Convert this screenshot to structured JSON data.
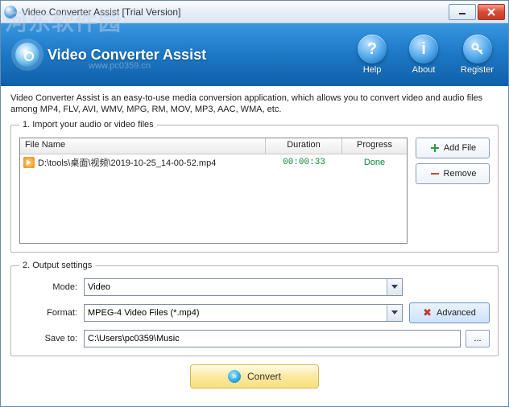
{
  "window": {
    "title": "Video Converter Assist [Trial Version]"
  },
  "header": {
    "app_name": "Video Converter Assist",
    "buttons": {
      "help": "Help",
      "about": "About",
      "register": "Register"
    }
  },
  "description": "Video Converter Assist is an easy-to-use media conversion application, which allows you to convert video and audio files among MP4, FLV, AVI, WMV, MPG, RM, MOV, MP3, AAC, WMA, etc.",
  "import": {
    "legend": "1. Import your audio or video files",
    "columns": {
      "name": "File Name",
      "duration": "Duration",
      "progress": "Progress"
    },
    "rows": [
      {
        "name": "D:\\tools\\桌面\\视频\\2019-10-25_14-00-52.mp4",
        "duration": "00:00:33",
        "progress": "Done"
      }
    ],
    "add_label": "Add File",
    "remove_label": "Remove"
  },
  "output": {
    "legend": "2. Output settings",
    "mode_label": "Mode:",
    "mode_value": "Video",
    "format_label": "Format:",
    "format_value": "MPEG-4 Video Files (*.mp4)",
    "advanced_label": "Advanced",
    "save_label": "Save to:",
    "save_value": "C:\\Users\\pc0359\\Music",
    "browse_label": "..."
  },
  "convert_label": "Convert",
  "watermark": {
    "main": "河东软件园",
    "sub": "www.pc0359.cn"
  }
}
